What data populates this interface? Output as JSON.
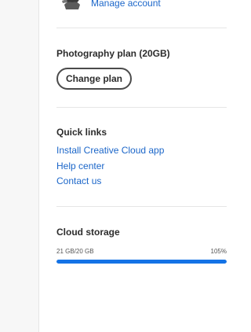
{
  "account": {
    "manage_label": "Manage account"
  },
  "plan": {
    "name": "Photography plan (20GB)",
    "change_label": "Change plan"
  },
  "quick_links": {
    "title": "Quick links",
    "items": [
      {
        "label": "Install Creative Cloud app"
      },
      {
        "label": "Help center"
      },
      {
        "label": "Contact us"
      }
    ]
  },
  "storage": {
    "title": "Cloud storage",
    "usage_text": "21 GB/20 GB",
    "percent_text": "105%",
    "fill_fraction": 1.05,
    "bar_color": "#1473e6"
  },
  "colors": {
    "link": "#1b66c9",
    "button_border": "#4b4b4b"
  }
}
